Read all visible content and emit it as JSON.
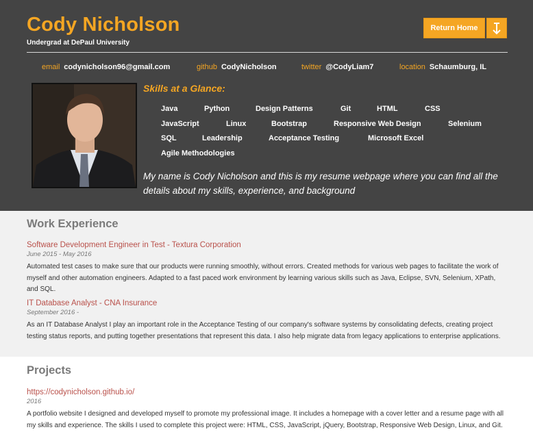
{
  "header": {
    "name": "Cody Nicholson",
    "subtitle": "Undergrad at DePaul University",
    "return_home_label": "Return Home",
    "scroll_down_icon": "arrow-down-icon"
  },
  "contacts": [
    {
      "label": "email",
      "value": "codynicholson96@gmail.com"
    },
    {
      "label": "github",
      "value": "CodyNicholson"
    },
    {
      "label": "twitter",
      "value": "@CodyLiam7"
    },
    {
      "label": "location",
      "value": "Schaumburg, IL"
    }
  ],
  "skills": {
    "title": "Skills at a Glance:",
    "items": [
      "Java",
      "Python",
      "Design Patterns",
      "Git",
      "HTML",
      "CSS",
      "JavaScript",
      "Linux",
      "Bootstrap",
      "Responsive Web Design",
      "Selenium",
      "SQL",
      "Leadership",
      "Acceptance Testing",
      "Microsoft Excel",
      "Agile Methodologies"
    ]
  },
  "bio": "My name is Cody Nicholson and this is my resume webpage where you can find all the details about my skills, experience, and background",
  "work": {
    "title": "Work Experience",
    "jobs": [
      {
        "title": "Software Development Engineer in Test - Textura Corporation",
        "date": "June 2015 - May 2016",
        "description": "Automated test cases to make sure that our products were running smoothly, without errors. Created methods for various web pages to facilitate the work of myself and other automation engineers. Adapted to a fast paced work environment by learning various skills such as Java, Eclipse, SVN, Selenium, XPath, and SQL."
      },
      {
        "title": "IT Database Analyst - CNA Insurance",
        "date": "September 2016 -",
        "description": "As an IT Database Analyst I play an important role in the Acceptance Testing of our company's software systems by consolidating defects, creating project testing status reports, and putting together presentations that represent this data. I also help migrate data from legacy applications to enterprise applications."
      }
    ]
  },
  "projects": {
    "title": "Projects",
    "items": [
      {
        "title": "https://codynicholson.github.io/",
        "date": "2016",
        "description": "A portfolio website I designed and developed myself to promote my professional image. It includes a homepage with a cover letter and a resume page with all my skills and experience. The skills I used to complete this project were: HTML, CSS, JavaScript, jQuery, Bootstrap, Responsive Web Design, Linux, and Git."
      }
    ]
  },
  "colors": {
    "accent": "#f5a623",
    "header_bg": "#444444",
    "link": "#b9504a",
    "work_bg": "#f1f1f1"
  }
}
